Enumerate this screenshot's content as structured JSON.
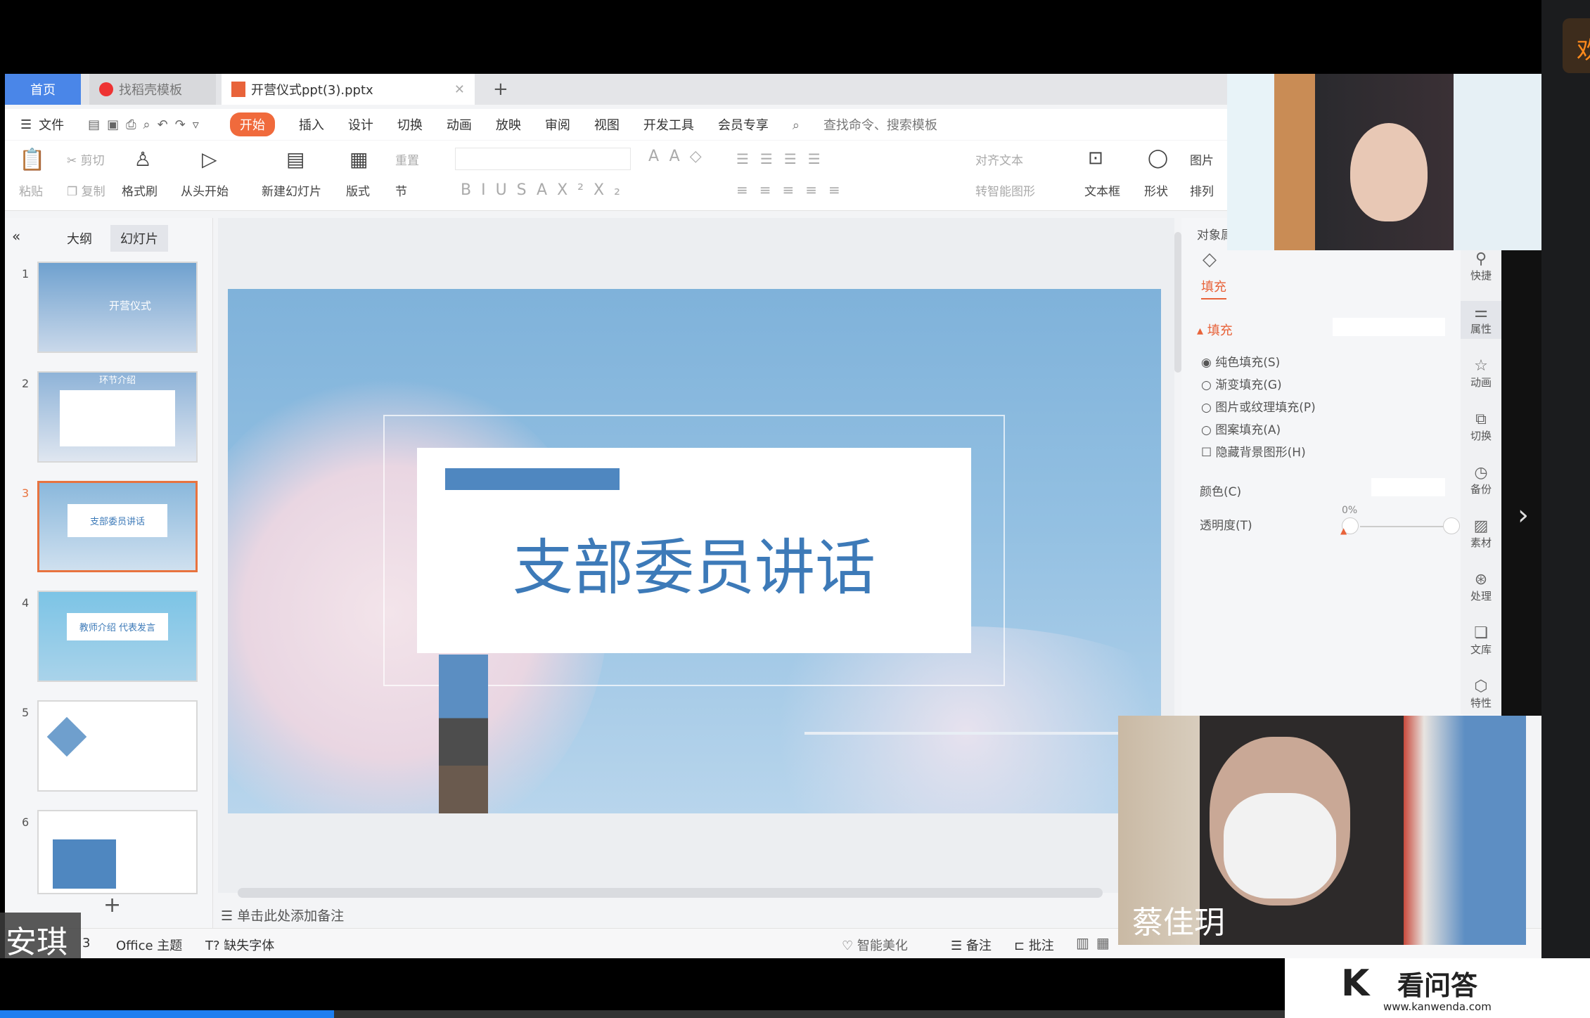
{
  "tabs": {
    "home": "首页",
    "template": "找稻壳模板",
    "file": "开营仪式ppt(3).pptx",
    "new_tab": "+"
  },
  "menu": {
    "file": "文件",
    "items": [
      "开始",
      "插入",
      "设计",
      "切换",
      "动画",
      "放映",
      "审阅",
      "视图",
      "开发工具",
      "会员专享"
    ],
    "search": "查找命令、搜索模板"
  },
  "ribbon": {
    "paste": "粘贴",
    "cut": "剪切",
    "copy": "复制",
    "format_painter": "格式刷",
    "from_start": "从头开始",
    "new_slide": "新建幻灯片",
    "layout": "版式",
    "reset": "重置",
    "section": "节",
    "align_text": "对齐文本",
    "smart_shape": "转智能图形",
    "textbox": "文本框",
    "shape": "形状",
    "picture": "图片",
    "arrange": "排列"
  },
  "left_panel": {
    "outline_tab": "大纲",
    "slides_tab": "幻灯片",
    "add": "+",
    "slides": [
      {
        "num": "1",
        "text": "开营仪式"
      },
      {
        "num": "2",
        "text": "环节介绍"
      },
      {
        "num": "3",
        "text": "支部委员讲话"
      },
      {
        "num": "4",
        "text": "教师介绍 代表发言"
      },
      {
        "num": "5",
        "text": ""
      },
      {
        "num": "6",
        "text": ""
      }
    ],
    "selected": 3
  },
  "slide": {
    "title": "支部委员讲话",
    "accent": "#3d7ab8"
  },
  "notes": {
    "placeholder": "单击此处添加备注"
  },
  "task_pane": {
    "header": "对象属",
    "tab": "填充",
    "section": "填充",
    "options": [
      {
        "label": "纯色填充(S)",
        "type": "radio",
        "checked": true
      },
      {
        "label": "渐变填充(G)",
        "type": "radio",
        "checked": false
      },
      {
        "label": "图片或纹理填充(P)",
        "type": "radio",
        "checked": false
      },
      {
        "label": "图案填充(A)",
        "type": "radio",
        "checked": false
      },
      {
        "label": "隐藏背景图形(H)",
        "type": "checkbox",
        "checked": false
      }
    ],
    "color_label": "颜色(C)",
    "transparency_label": "透明度(T)",
    "transparency_value": "0%"
  },
  "side_icons": [
    "快捷",
    "属性",
    "动画",
    "切换",
    "备份",
    "素材",
    "处理",
    "文库",
    "特性"
  ],
  "status": {
    "slide_num": "3",
    "theme": "Office 主题",
    "missing_font": "缺失字体",
    "beautify": "智能美化",
    "notes": "备注",
    "comments": "批注"
  },
  "participants": {
    "bottom_left": "安琪",
    "bottom_right": "蔡佳玥"
  },
  "side_badge": "欢",
  "watermark": {
    "name": "看问答",
    "url": "www.kanwenda.com"
  },
  "video_progress": 0.21
}
